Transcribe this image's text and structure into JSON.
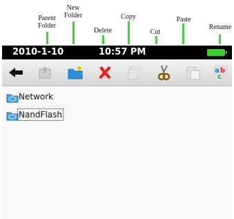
{
  "annotations": [
    {
      "name": "parent-folder",
      "text": "Parent\nFolder"
    },
    {
      "name": "new-folder",
      "text": "New\nFolder"
    },
    {
      "name": "delete",
      "text": "Delete"
    },
    {
      "name": "copy",
      "text": "Copy"
    },
    {
      "name": "cut",
      "text": "Cut"
    },
    {
      "name": "paste",
      "text": "Paste"
    },
    {
      "name": "rename",
      "text": "Rename"
    }
  ],
  "statusbar": {
    "date": "2010-1-10",
    "time": "10:57 PM",
    "battery_color": "#39d02f"
  },
  "toolbar": {
    "buttons": [
      {
        "name": "back-button",
        "icon": "back-arrow-icon"
      },
      {
        "name": "parent-folder-button",
        "icon": "parent-folder-icon"
      },
      {
        "name": "new-folder-button",
        "icon": "new-folder-icon"
      },
      {
        "name": "delete-button",
        "icon": "delete-x-icon"
      },
      {
        "name": "copy-button",
        "icon": "copy-icon"
      },
      {
        "name": "cut-button",
        "icon": "scissors-icon"
      },
      {
        "name": "paste-button",
        "icon": "paste-icon"
      },
      {
        "name": "rename-button",
        "icon": "rename-abc-icon"
      }
    ]
  },
  "files": [
    {
      "label": "Network",
      "icon": "network-folder-icon",
      "selected": false
    },
    {
      "label": "NandFlash",
      "icon": "storage-folder-icon",
      "selected": true
    }
  ]
}
